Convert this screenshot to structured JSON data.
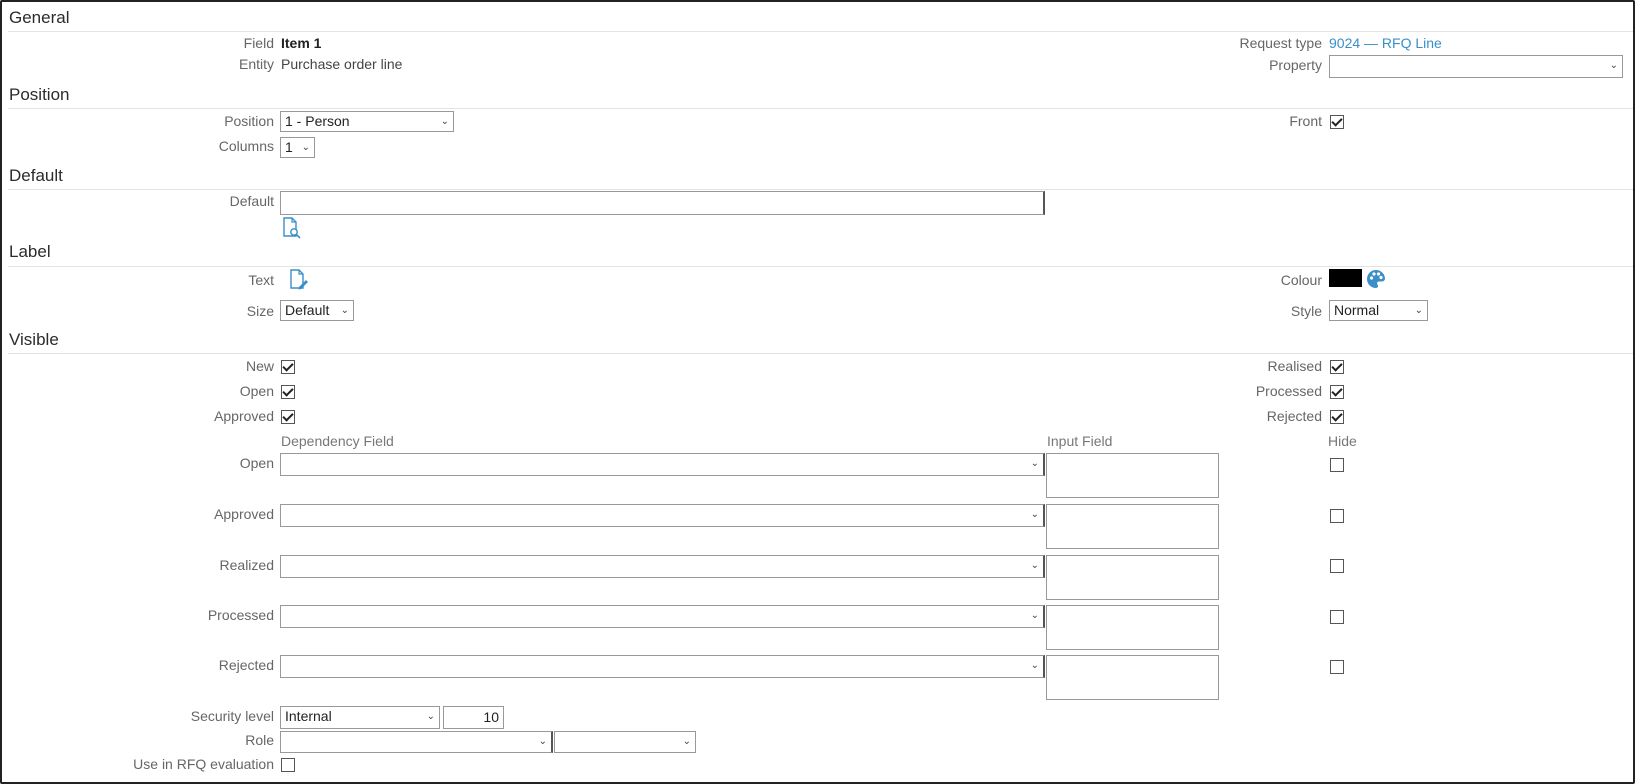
{
  "sections": {
    "general": "General",
    "position": "Position",
    "default": "Default",
    "label": "Label",
    "visible": "Visible"
  },
  "general": {
    "field_label": "Field",
    "field_value": "Item 1",
    "entity_label": "Entity",
    "entity_value": "Purchase order line",
    "request_type_label": "Request type",
    "request_type_value": "9024 — RFQ Line",
    "property_label": "Property",
    "property_value": ""
  },
  "position": {
    "position_label": "Position",
    "position_value": "1 - Person",
    "columns_label": "Columns",
    "columns_value": "1",
    "front_label": "Front",
    "front_checked": true
  },
  "default": {
    "default_label": "Default",
    "default_value": ""
  },
  "label": {
    "text_label": "Text",
    "size_label": "Size",
    "size_value": "Default",
    "colour_label": "Colour",
    "colour_value": "#000000",
    "style_label": "Style",
    "style_value": "Normal"
  },
  "visible": {
    "new_label": "New",
    "open_label": "Open",
    "approved_label": "Approved",
    "realised_label": "Realised",
    "processed_label": "Processed",
    "rejected_label": "Rejected",
    "checks": {
      "new": true,
      "open": true,
      "approved": true,
      "realised": true,
      "processed": true,
      "rejected": true
    },
    "dependency_header": "Dependency Field",
    "input_header": "Input Field",
    "hide_header": "Hide",
    "rows": [
      {
        "label": "Open",
        "dependency": "",
        "input": "",
        "hide": false
      },
      {
        "label": "Approved",
        "dependency": "",
        "input": "",
        "hide": false
      },
      {
        "label": "Realized",
        "dependency": "",
        "input": "",
        "hide": false
      },
      {
        "label": "Processed",
        "dependency": "",
        "input": "",
        "hide": false
      },
      {
        "label": "Rejected",
        "dependency": "",
        "input": "",
        "hide": false
      }
    ],
    "security_label": "Security level",
    "security_value": "Internal",
    "security_number": "10",
    "role_label": "Role",
    "role_value": "",
    "role_value2": "",
    "rfq_eval_label": "Use in RFQ evaluation",
    "rfq_eval_checked": false
  },
  "icons": {
    "default_lookup": "document-search-icon",
    "text_edit": "document-edit-icon",
    "colour_picker": "palette-icon"
  },
  "colors": {
    "link": "#3a8fc8",
    "icon": "#3a8fc8"
  }
}
